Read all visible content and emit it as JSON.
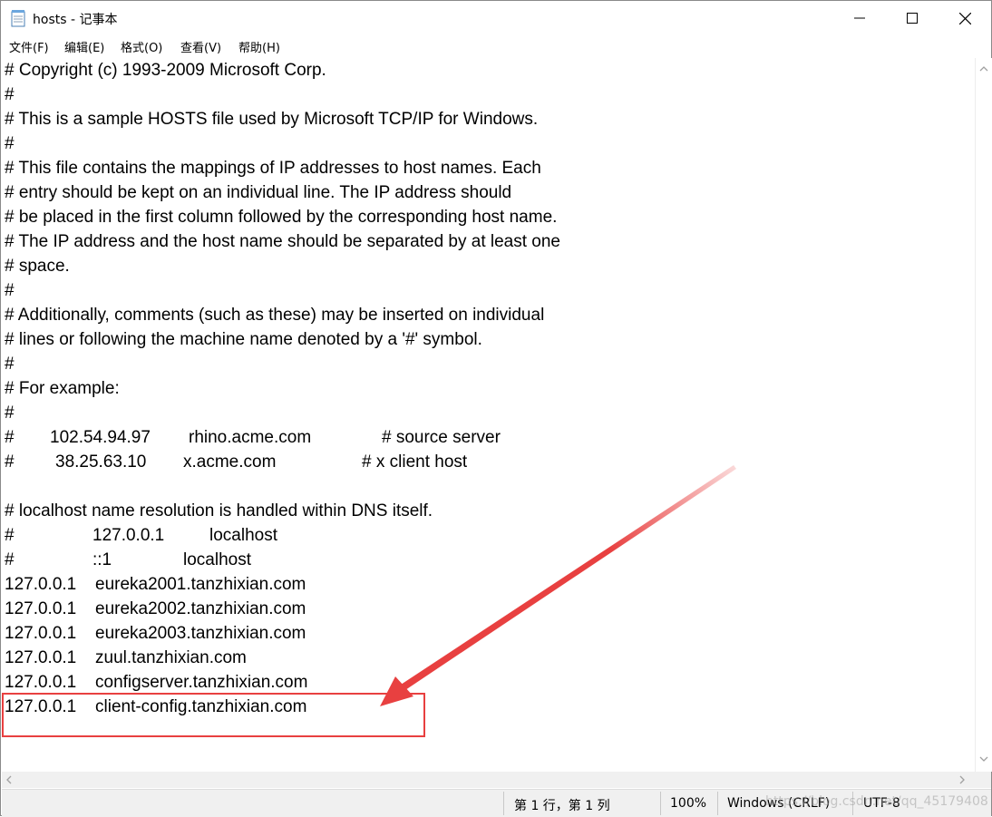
{
  "window": {
    "title": "hosts - 记事本",
    "icon": "notepad-icon"
  },
  "menu": {
    "file": "文件(F)",
    "edit": "编辑(E)",
    "format": "格式(O)",
    "view": "查看(V)",
    "help": "帮助(H)"
  },
  "lines": [
    {
      "segs": [
        "# Copyright (c) 1993-2009 Microsoft Corp."
      ]
    },
    {
      "segs": [
        "#"
      ]
    },
    {
      "segs": [
        "# This is a sample HOSTS file used by Microsoft TCP/IP for Windows."
      ]
    },
    {
      "segs": [
        "#"
      ]
    },
    {
      "segs": [
        "# This file contains the mappings of IP addresses to host names. Each"
      ]
    },
    {
      "segs": [
        "# entry should be kept on an individual line. The IP address should"
      ]
    },
    {
      "segs": [
        "# be placed in the first column followed by the corresponding host name."
      ]
    },
    {
      "segs": [
        "# The IP address and the host name should be separated by at least one"
      ]
    },
    {
      "segs": [
        "# space."
      ]
    },
    {
      "segs": [
        "#"
      ]
    },
    {
      "segs": [
        "# Additionally, comments (such as these) may be inserted on individual"
      ]
    },
    {
      "segs": [
        "# lines or following the machine name denoted by a '#' symbol."
      ]
    },
    {
      "segs": [
        "#"
      ]
    },
    {
      "segs": [
        "# For example:"
      ]
    },
    {
      "segs": [
        "#"
      ]
    },
    {
      "segs": [
        "#",
        "102.54.94.97",
        "rhino.acme.com",
        "# source server"
      ]
    },
    {
      "segs": [
        "#",
        "38.25.63.10",
        "x.acme.com",
        "# x client host"
      ]
    },
    {
      "segs": [
        ""
      ]
    },
    {
      "segs": [
        "# localhost name resolution is handled within DNS itself."
      ]
    },
    {
      "segs": [
        "#",
        "127.0.0.1",
        "localhost"
      ]
    },
    {
      "segs": [
        "#",
        "::1",
        "localhost"
      ]
    },
    {
      "segs": [
        "127.0.0.1",
        "eureka2001.tanzhixian.com"
      ]
    },
    {
      "segs": [
        "127.0.0.1",
        "eureka2002.tanzhixian.com"
      ]
    },
    {
      "segs": [
        "127.0.0.1",
        "eureka2003.tanzhixian.com"
      ]
    },
    {
      "segs": [
        "127.0.0.1",
        "zuul.tanzhixian.com"
      ]
    },
    {
      "segs": [
        "127.0.0.1",
        "configserver.tanzhixian.com"
      ]
    },
    {
      "segs": [
        "127.0.0.1",
        "client-config.tanzhixian.com"
      ]
    }
  ],
  "status": {
    "position": "第 1 行，第 1 列",
    "zoom": "100%",
    "line_ending": "Windows (CRLF)",
    "encoding": "UTF-8"
  },
  "watermark": "https://blog.csdn.net/qq_45179408",
  "colors": {
    "annotation": "#e84040",
    "statusbar_bg": "#f0f0f0"
  }
}
